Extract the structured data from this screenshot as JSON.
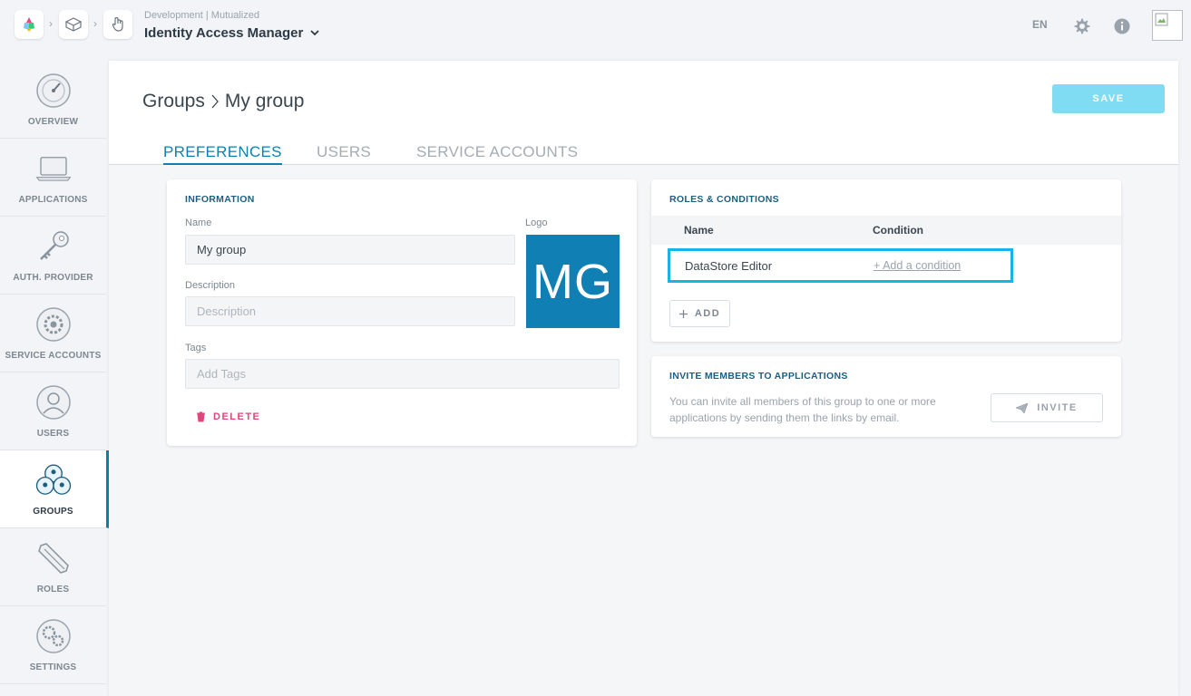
{
  "header": {
    "environment": "Development | Mutualized",
    "app_title": "Identity Access Manager",
    "language": "EN"
  },
  "sidebar": {
    "items": [
      {
        "label": "OVERVIEW",
        "icon": "gauge-icon"
      },
      {
        "label": "APPLICATIONS",
        "icon": "laptop-icon"
      },
      {
        "label": "AUTH. PROVIDER",
        "icon": "key-icon"
      },
      {
        "label": "SERVICE ACCOUNTS",
        "icon": "cog-circle-icon"
      },
      {
        "label": "USERS",
        "icon": "user-icon"
      },
      {
        "label": "GROUPS",
        "icon": "group-icon",
        "active": true
      },
      {
        "label": "ROLES",
        "icon": "pencil-icon"
      },
      {
        "label": "SETTINGS",
        "icon": "gears-icon"
      }
    ]
  },
  "page": {
    "breadcrumb_parent": "Groups",
    "breadcrumb_current": "My group",
    "save_label": "SAVE",
    "tabs": [
      {
        "label": "PREFERENCES",
        "active": true
      },
      {
        "label": "USERS"
      },
      {
        "label": "SERVICE ACCOUNTS"
      }
    ]
  },
  "information": {
    "title": "INFORMATION",
    "name_label": "Name",
    "name_value": "My group",
    "logo_label": "Logo",
    "logo_initials": "MG",
    "description_label": "Description",
    "description_placeholder": "Description",
    "tags_label": "Tags",
    "tags_placeholder": "Add Tags",
    "delete_label": "DELETE"
  },
  "roles": {
    "title": "ROLES & CONDITIONS",
    "col_name": "Name",
    "col_condition": "Condition",
    "rows": [
      {
        "name": "DataStore Editor",
        "condition": "+ Add a condition"
      }
    ],
    "add_label": "ADD"
  },
  "invite": {
    "title": "INVITE MEMBERS TO APPLICATIONS",
    "text": "You can invite all members of this group to one or more applications by sending them the links by email.",
    "button_label": "INVITE"
  },
  "colors": {
    "accent": "#0f7fb4",
    "save": "#7fdcf2",
    "delete": "#e0457b",
    "highlight": "#1ab3e6"
  }
}
